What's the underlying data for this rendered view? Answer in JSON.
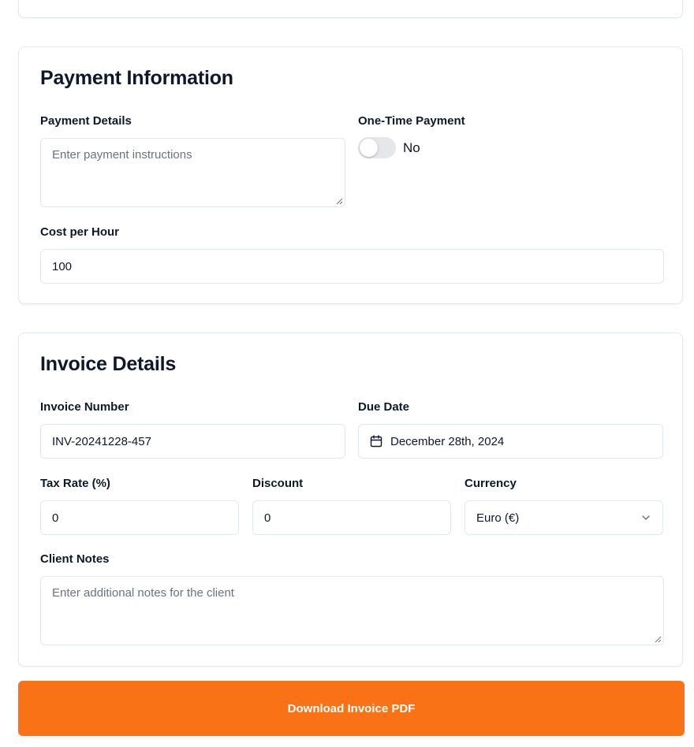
{
  "payment_section": {
    "title": "Payment Information",
    "payment_details_label": "Payment Details",
    "payment_details_placeholder": "Enter payment instructions",
    "one_time_label": "One-Time Payment",
    "one_time_state_text": "No",
    "one_time_enabled": false,
    "cost_label": "Cost per Hour",
    "cost_value": "100"
  },
  "invoice_section": {
    "title": "Invoice Details",
    "invoice_number_label": "Invoice Number",
    "invoice_number_value": "INV-20241228-457",
    "due_date_label": "Due Date",
    "due_date_value": "December 28th, 2024",
    "due_date_icon": "calendar-icon",
    "tax_rate_label": "Tax Rate (%)",
    "tax_rate_value": "0",
    "discount_label": "Discount",
    "discount_value": "0",
    "currency_label": "Currency",
    "currency_value": "Euro (€)",
    "currency_icon": "chevron-down-icon",
    "client_notes_label": "Client Notes",
    "client_notes_placeholder": "Enter additional notes for the client"
  },
  "actions": {
    "download_label": "Download Invoice PDF"
  },
  "colors": {
    "accent": "#f97316",
    "border": "#e2e8f0",
    "text": "#0f172a",
    "placeholder": "#6b7280",
    "toggle_off": "#e5e7eb"
  }
}
